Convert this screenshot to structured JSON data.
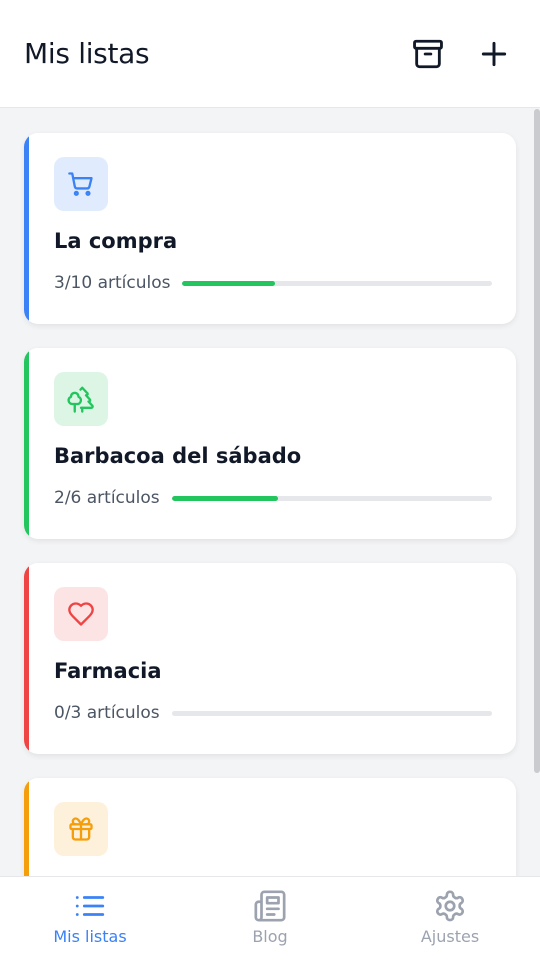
{
  "header": {
    "title": "Mis listas",
    "archive_icon": "archive-icon",
    "add_icon": "plus-icon"
  },
  "lists": [
    {
      "title": "La compra",
      "count_label": "3/10 artículos",
      "progress": 0.3,
      "icon": "shopping-cart-icon",
      "accent": "#3b82f6",
      "icon_bg": "#e0ecfd",
      "icon_color": "#3b82f6"
    },
    {
      "title": "Barbacoa del sábado",
      "count_label": "2/6 artículos",
      "progress": 0.333,
      "icon": "trees-icon",
      "accent": "#22c55e",
      "icon_bg": "#ddf5e5",
      "icon_color": "#22c55e"
    },
    {
      "title": "Farmacia",
      "count_label": "0/3 artículos",
      "progress": 0,
      "icon": "heart-icon",
      "accent": "#ef4444",
      "icon_bg": "#fde4e4",
      "icon_color": "#ef4444"
    },
    {
      "title": "",
      "count_label": "",
      "progress": 0,
      "icon": "gift-icon",
      "accent": "#f59e0b",
      "icon_bg": "#fdf1dc",
      "icon_color": "#f59e0b"
    }
  ],
  "nav": {
    "items": [
      {
        "label": "Mis listas",
        "icon": "list-icon",
        "active": true
      },
      {
        "label": "Blog",
        "icon": "newspaper-icon",
        "active": false
      },
      {
        "label": "Ajustes",
        "icon": "gear-icon",
        "active": false
      }
    ],
    "active_color": "#3b82f6",
    "inactive_color": "#9ca3af"
  },
  "colors": {
    "progress_fill": "#22c55e",
    "progress_track": "#e5e7eb",
    "background": "#f3f4f6"
  }
}
